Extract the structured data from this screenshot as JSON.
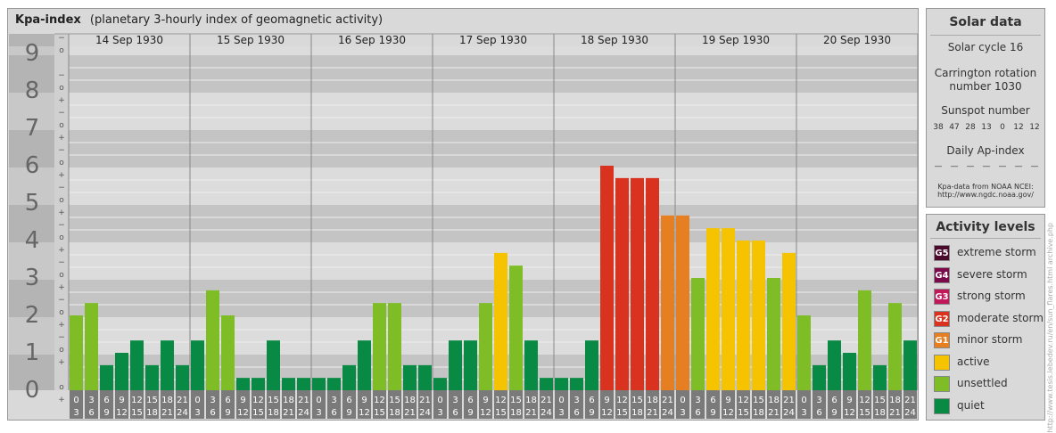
{
  "header": {
    "title": "Kpa-index",
    "subtitle": "(planetary 3-hourly index of geomagnetic activity)"
  },
  "chart_data": {
    "type": "bar",
    "title": "Kpa-index",
    "subtitle": "(planetary 3-hourly index of geomagnetic activity)",
    "ylim": [
      0,
      9
    ],
    "y_ticks": [
      "0",
      "1",
      "2",
      "3",
      "4",
      "5",
      "6",
      "7",
      "8",
      "9"
    ],
    "minor_ticks": [
      "+",
      "o",
      "−"
    ],
    "days": [
      "14 Sep 1930",
      "15 Sep 1930",
      "16 Sep 1930",
      "17 Sep 1930",
      "18 Sep 1930",
      "19 Sep 1930",
      "20 Sep 1930"
    ],
    "intervals": [
      [
        "0",
        "3"
      ],
      [
        "3",
        "6"
      ],
      [
        "6",
        "9"
      ],
      [
        "9",
        "12"
      ],
      [
        "12",
        "15"
      ],
      [
        "15",
        "18"
      ],
      [
        "18",
        "21"
      ],
      [
        "21",
        "24"
      ]
    ],
    "values": [
      [
        2.0,
        2.33,
        0.67,
        1.0,
        1.33,
        0.67,
        1.33,
        0.67
      ],
      [
        1.33,
        2.67,
        2.0,
        0.33,
        0.33,
        1.33,
        0.33,
        0.33
      ],
      [
        0.33,
        0.33,
        0.67,
        1.33,
        2.33,
        2.33,
        0.67,
        0.67
      ],
      [
        0.33,
        1.33,
        1.33,
        2.33,
        3.67,
        3.33,
        1.33,
        0.33
      ],
      [
        0.33,
        0.33,
        1.33,
        6.0,
        5.67,
        5.67,
        5.67,
        4.67
      ],
      [
        4.67,
        3.0,
        4.33,
        4.33,
        4.0,
        4.0,
        3.0,
        3.67
      ],
      [
        2.0,
        0.67,
        1.33,
        1.0,
        2.67,
        0.67,
        2.33,
        1.33
      ]
    ]
  },
  "solar": {
    "title": "Solar data",
    "cycle": "Solar cycle 16",
    "rotation_line1": "Carrington rotation",
    "rotation_line2": "number 1030",
    "sunspot_title": "Sunspot number",
    "sunspots": [
      "38",
      "47",
      "28",
      "13",
      "0",
      "12",
      "12"
    ],
    "ap_title": "Daily Ap-index",
    "ap_values": [
      "—",
      "—",
      "—",
      "—",
      "—",
      "—",
      "—"
    ],
    "source_line1": "Kpa-data from NOAA NCEI:",
    "source_line2": "http://www.ngdc.noaa.gov/"
  },
  "legend": {
    "title": "Activity levels",
    "items": [
      {
        "code": "G5",
        "label": "extreme storm",
        "color": "#4a0a2a"
      },
      {
        "code": "G4",
        "label": "severe storm",
        "color": "#7a0a4a"
      },
      {
        "code": "G3",
        "label": "strong storm",
        "color": "#c0185a"
      },
      {
        "code": "G2",
        "label": "moderate storm",
        "color": "#d93320"
      },
      {
        "code": "G1",
        "label": "minor storm",
        "color": "#e67e22"
      },
      {
        "code": "",
        "label": "active",
        "color": "#f5c300"
      },
      {
        "code": "",
        "label": "unsettled",
        "color": "#7ebd26"
      },
      {
        "code": "",
        "label": "quiet",
        "color": "#088a45"
      }
    ]
  },
  "credit": "http://www.tesis.lebedev.ru/en/sun_flares.html archive.php"
}
